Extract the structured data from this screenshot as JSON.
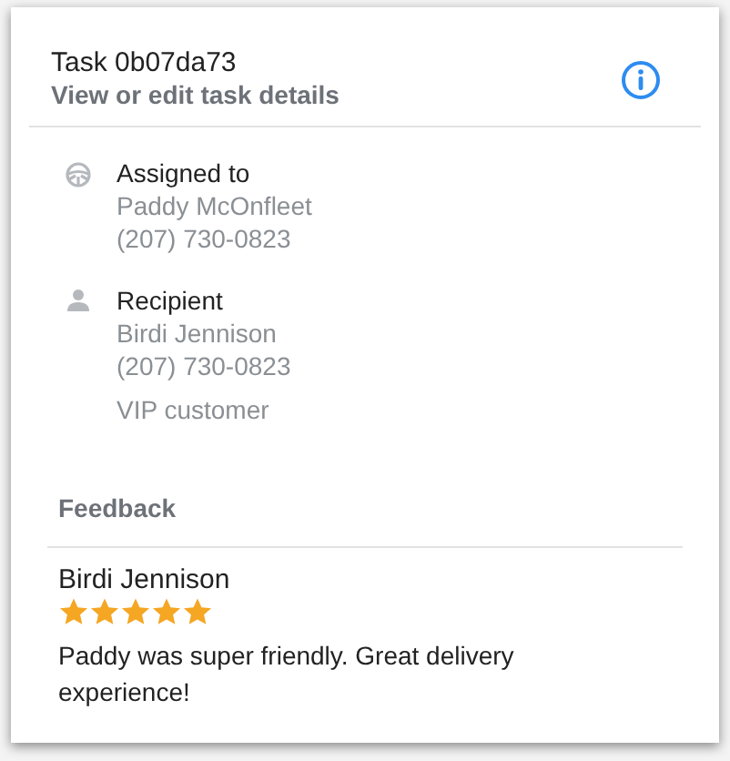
{
  "header": {
    "title": "Task 0b07da73",
    "subtitle": "View or edit task details"
  },
  "sections": [
    {
      "kind": "driver",
      "label": "Assigned to",
      "lines": [
        "Paddy McOnfleet",
        "(207) 730-0823"
      ]
    },
    {
      "kind": "person",
      "label": "Recipient",
      "lines": [
        "Birdi Jennison",
        "(207) 730-0823"
      ],
      "note": "VIP customer"
    }
  ],
  "feedback": {
    "heading": "Feedback",
    "author": "Birdi Jennison",
    "stars": 5,
    "comment": "Paddy was super friendly. Great delivery experience!"
  }
}
